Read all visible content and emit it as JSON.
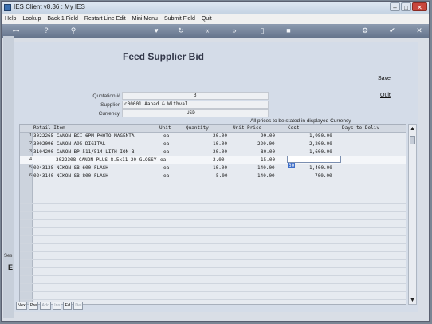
{
  "window": {
    "title": "IES Client v8.36 : My IES",
    "min": "–",
    "max": "□",
    "close": "✕"
  },
  "menu": [
    "Help",
    "Lookup",
    "Back 1 Field",
    "Restart Line Edit",
    "Mini Menu",
    "Submit Field",
    "Quit"
  ],
  "toolbar_icons": {
    "key": "⊶",
    "help": "?",
    "search": "⚲",
    "heart": "♥",
    "refresh": "↻",
    "rewind": "«",
    "forward": "»",
    "doc": "▯",
    "stop": "■",
    "settings": "⚙",
    "ok": "✔",
    "cancel": "✕"
  },
  "form": {
    "title": "Feed Supplier Bid",
    "save_link": "Save",
    "quit_link": "Quit",
    "quotation_label": "Quotation #",
    "quotation_value": "3",
    "supplier_label": "Supplier",
    "supplier_value": "c00001 Aanad & Withval",
    "currency_label": "Currency",
    "currency_value": "USD",
    "prices_note": "All prices to be stated in displayed Currency"
  },
  "grid": {
    "headers": {
      "item": "Retail Item",
      "unit": "Unit",
      "qty": "Quantity",
      "price": "Unit Price",
      "cost": "Cost",
      "days": "Days to Deliv"
    },
    "rows": [
      {
        "n": "1",
        "item": "3022265 CANON BCI-6PM PHOTO MAGENTA",
        "unit": "ea",
        "qty": "20.00",
        "price": "99.00",
        "cost": "1,980.00"
      },
      {
        "n": "2",
        "item": "3002096 CANON A95 DIGITAL",
        "unit": "ea",
        "qty": "10.00",
        "price": "220.00",
        "cost": "2,200.00"
      },
      {
        "n": "3",
        "item": "3104290 CANON BP-511/514 LITH-ION B",
        "unit": "ea",
        "qty": "20.00",
        "price": "80.00",
        "cost": "1,600.00"
      },
      {
        "n": "4",
        "item": "3022308 CANON PLUS 8.5x11 20 GLOSSY",
        "unit": "ea",
        "qty": "2.00",
        "price": "15.00",
        "cost": "30"
      },
      {
        "n": "5",
        "item": "0243138 NIKON SB-600 FLASH",
        "unit": "ea",
        "qty": "10.00",
        "price": "140.00",
        "cost": "1,400.00"
      },
      {
        "n": "6",
        "item": "0243140 NIKON SB-800 FLASH",
        "unit": "ea",
        "qty": "5.00",
        "price": "140.00",
        "cost": "700.00"
      }
    ]
  },
  "side": {
    "label": "Ses",
    "letter": "E"
  },
  "bottom_buttons": [
    {
      "label": "Nex",
      "enabled": true
    },
    {
      "label": "Pre",
      "enabled": true
    },
    {
      "label": "Add",
      "enabled": false
    },
    {
      "label": "Ins",
      "enabled": false
    },
    {
      "label": "Ed",
      "enabled": true
    },
    {
      "label": "Del",
      "enabled": false
    }
  ],
  "scroll": {
    "up": "▲",
    "down": "▼"
  }
}
